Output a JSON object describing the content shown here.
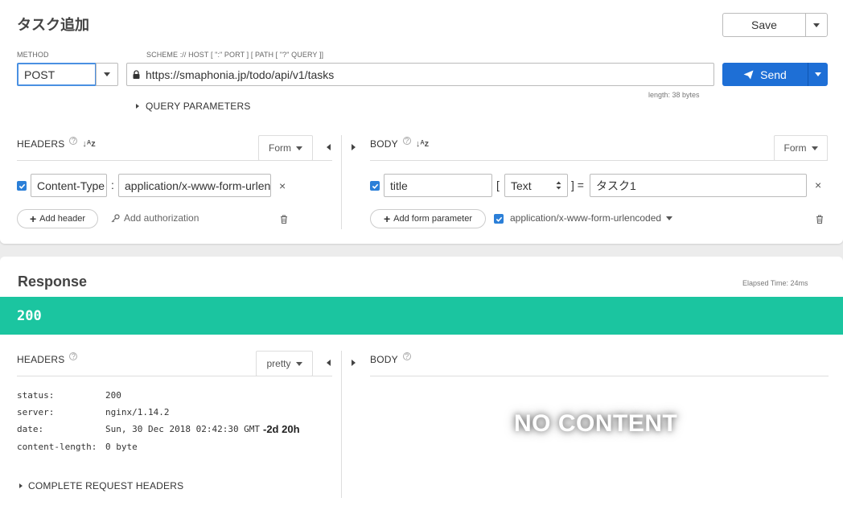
{
  "request": {
    "title": "タスク追加",
    "save_label": "Save",
    "method_label": "METHOD",
    "method_value": "POST",
    "url_hint": "SCHEME :// HOST [ \":\" PORT ] [ PATH [ \"?\" QUERY ]]",
    "url_value": "https://smaphonia.jp/todo/api/v1/tasks",
    "length_text": "length: 38 bytes",
    "send_label": "Send",
    "query_params_label": "QUERY PARAMETERS"
  },
  "headers": {
    "label": "HEADERS",
    "mode": "Form",
    "rows": [
      {
        "checked": true,
        "name": "Content-Type",
        "value": "application/x-www-form-urlencoded"
      }
    ],
    "add_header_label": "Add header",
    "add_auth_label": "Add authorization"
  },
  "body": {
    "label": "BODY",
    "mode": "Form",
    "rows": [
      {
        "checked": true,
        "name": "title",
        "type": "Text",
        "value": "タスク1"
      }
    ],
    "add_param_label": "Add form parameter",
    "encoding_label": "application/x-www-form-urlencoded",
    "encoding_checked": true
  },
  "response": {
    "title": "Response",
    "elapsed": "Elapsed Time: 24ms",
    "status_code": "200",
    "headers_label": "HEADERS",
    "format": "pretty",
    "body_label": "BODY",
    "headers": [
      {
        "key": "status:",
        "value": "200",
        "extra": ""
      },
      {
        "key": "server:",
        "value": "nginx/1.14.2",
        "extra": ""
      },
      {
        "key": "date:",
        "value": "Sun, 30 Dec 2018 02:42:30 GMT",
        "extra": "-2d 20h"
      },
      {
        "key": "content-length:",
        "value": "0 byte",
        "extra": ""
      }
    ],
    "complete_headers_label": "COMPLETE REQUEST HEADERS",
    "no_content": "NO CONTENT"
  },
  "colors": {
    "accent": "#1e6fd6",
    "status_ok": "#1bc5a0",
    "checkbox": "#2b7fd8"
  }
}
